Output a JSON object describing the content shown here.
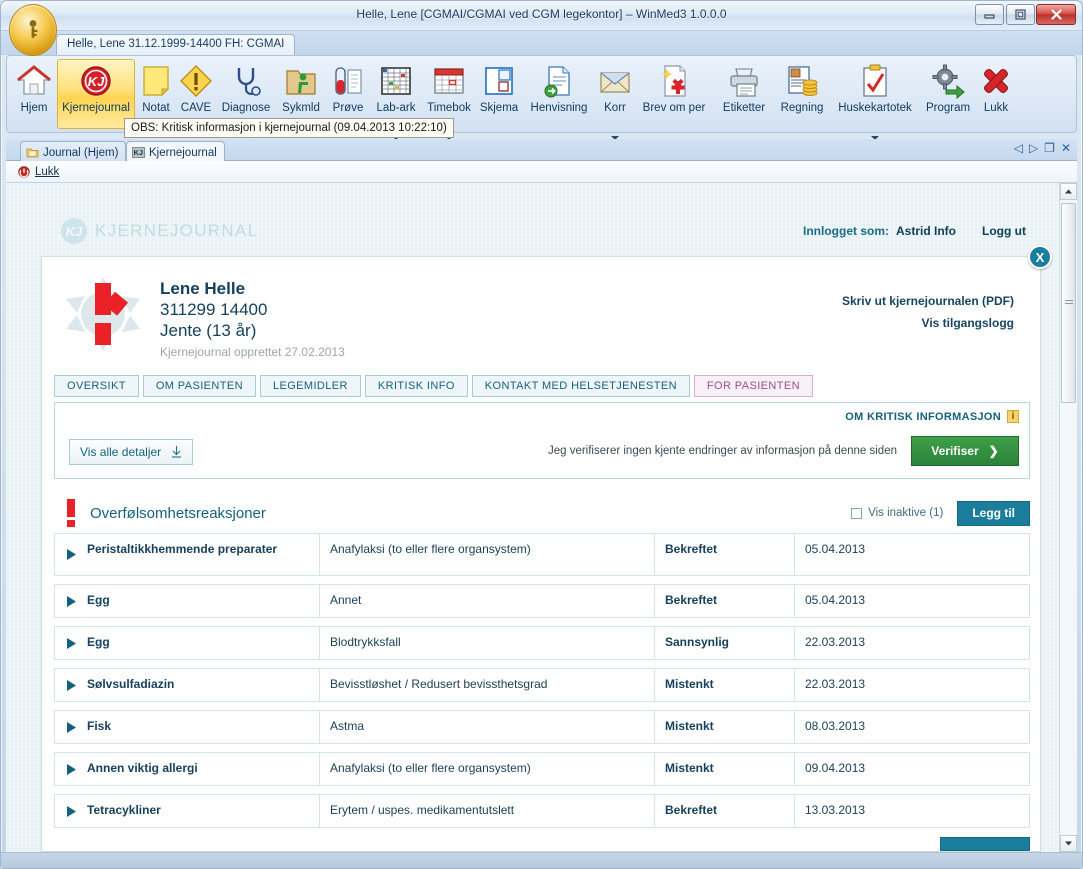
{
  "window": {
    "title": "Helle, Lene [CGMAI/CGMAI ved CGM legekontor] – WinMed3 1.0.0.0",
    "minimize_label": "minimize-icon",
    "maximize_label": "maximize-icon",
    "close_label": "close-icon",
    "patient_tab": "Helle, Lene 31.12.1999-14400 FH: CGMAI"
  },
  "ribbon": {
    "tools": [
      {
        "label": "Hjem",
        "icon": "house-icon",
        "active": false,
        "caret": false
      },
      {
        "label": "Kjernejournal",
        "icon": "kj-red-circle-icon",
        "active": true,
        "caret": false
      },
      {
        "label": "Notat",
        "icon": "yellow-note-icon",
        "active": false,
        "caret": false
      },
      {
        "label": "CAVE",
        "icon": "warning-diamond-icon",
        "active": false,
        "caret": false
      },
      {
        "label": "Diagnose",
        "icon": "stethoscope-icon",
        "active": false,
        "caret": false
      },
      {
        "label": "Sykmld",
        "icon": "folder-disabled-icon",
        "active": false,
        "caret": false
      },
      {
        "label": "Prøve",
        "icon": "test-tube-icon",
        "active": false,
        "caret": false
      },
      {
        "label": "Lab-ark",
        "icon": "spreadsheet-icon",
        "active": false,
        "caret": true
      },
      {
        "label": "Timebok",
        "icon": "calendar-icon",
        "active": false,
        "caret": true
      },
      {
        "label": "Skjema",
        "icon": "form-icon",
        "active": false,
        "caret": false
      },
      {
        "label": "Henvisning",
        "icon": "document-arrow-icon",
        "active": false,
        "caret": false
      },
      {
        "label": "Korr",
        "icon": "envelope-icon",
        "active": false,
        "caret": true
      },
      {
        "label": "Brev om per",
        "icon": "letter-star-icon",
        "active": false,
        "caret": false
      },
      {
        "label": "Etiketter",
        "icon": "printer-icon",
        "active": false,
        "caret": false
      },
      {
        "label": "Regning",
        "icon": "invoice-coins-icon",
        "active": false,
        "caret": false
      },
      {
        "label": "Huskekartotek",
        "icon": "clipboard-check-icon",
        "active": false,
        "caret": true
      },
      {
        "label": "Program",
        "icon": "gear-arrow-icon",
        "active": false,
        "caret": false
      },
      {
        "label": "Lukk",
        "icon": "red-x-icon",
        "active": false,
        "caret": false
      }
    ],
    "tooltip": "OBS: Kritisk informasjon i kjernejournal (09.04.2013 10:22:10)"
  },
  "journal_tabs": {
    "items": [
      {
        "label": "Journal (Hjem)",
        "icon": "journal-folder-icon",
        "active": false
      },
      {
        "label": "Kjernejournal",
        "icon": "kj-badge-icon",
        "active": true
      }
    ],
    "controls": [
      "prev-icon",
      "next-icon",
      "restore-icon",
      "close-icon"
    ]
  },
  "lukk_bar": {
    "label": "Lukk",
    "icon": "stop-circle-icon"
  },
  "kj_page": {
    "brand": "KJERNEJOURNAL",
    "brand_mark": "KJ",
    "logged_in_label": "Innlogget som:",
    "logged_in_user": "Astrid Info",
    "logout": "Logg ut",
    "close_card": "X"
  },
  "patient": {
    "name": "Lene Helle",
    "id": "311299 14400",
    "sex_age": "Jente (13 år)",
    "created": "Kjernejournal opprettet 27.02.2013"
  },
  "doc_links": [
    "Skriv ut kjernejournalen (PDF)",
    "Vis tilgangslogg"
  ],
  "nav_tabs": [
    {
      "label": "OVERSIKT",
      "selected": false
    },
    {
      "label": "OM PASIENTEN",
      "selected": false
    },
    {
      "label": "LEGEMIDLER",
      "selected": false
    },
    {
      "label": "KRITISK INFO",
      "selected": false
    },
    {
      "label": "KONTAKT MED HELSETJENESTEN",
      "selected": false
    },
    {
      "label": "FOR PASIENTEN",
      "selected": true
    }
  ],
  "info_panel": {
    "om_kritisk": "OM KRITISK INFORMASJON",
    "info_badge": "i",
    "vis_alle": "Vis alle detaljer",
    "verify_text": "Jeg verifiserer ingen kjente endringer av informasjon på denne siden",
    "verify_button": "Verifiser",
    "verify_chevron": "❯"
  },
  "allergy_section": {
    "title": "Overfølsomhetsreaksjoner",
    "show_inactive": "Vis inaktive (1)",
    "add_button": "Legg til",
    "rows": [
      {
        "name": "Peristaltikkhemmende preparater",
        "reaction": "Anafylaksi (to eller flere organsystem)",
        "status": "Bekreftet",
        "date": "05.04.2013"
      },
      {
        "name": "Egg",
        "reaction": "Annet",
        "status": "Bekreftet",
        "date": "05.04.2013"
      },
      {
        "name": "Egg",
        "reaction": "Blodtrykksfall",
        "status": "Sannsynlig",
        "date": "22.03.2013"
      },
      {
        "name": "Sølvsulfadiazin",
        "reaction": "Bevisstløshet / Redusert bevissthetsgrad",
        "status": "Mistenkt",
        "date": "22.03.2013"
      },
      {
        "name": "Fisk",
        "reaction": "Astma",
        "status": "Mistenkt",
        "date": "08.03.2013"
      },
      {
        "name": "Annen viktig allergi",
        "reaction": "Anafylaksi (to eller flere organsystem)",
        "status": "Mistenkt",
        "date": "09.04.2013"
      },
      {
        "name": "Tetracykliner",
        "reaction": "Erytem / uspes. medikamentutslett",
        "status": "Bekreftet",
        "date": "13.03.2013"
      }
    ]
  },
  "colors": {
    "accent_teal": "#1b7d9c",
    "verify_green": "#2c8239",
    "kj_red": "#e8212b",
    "pink_tab": "#9c4d90",
    "page_bg": "#eef5f8"
  }
}
